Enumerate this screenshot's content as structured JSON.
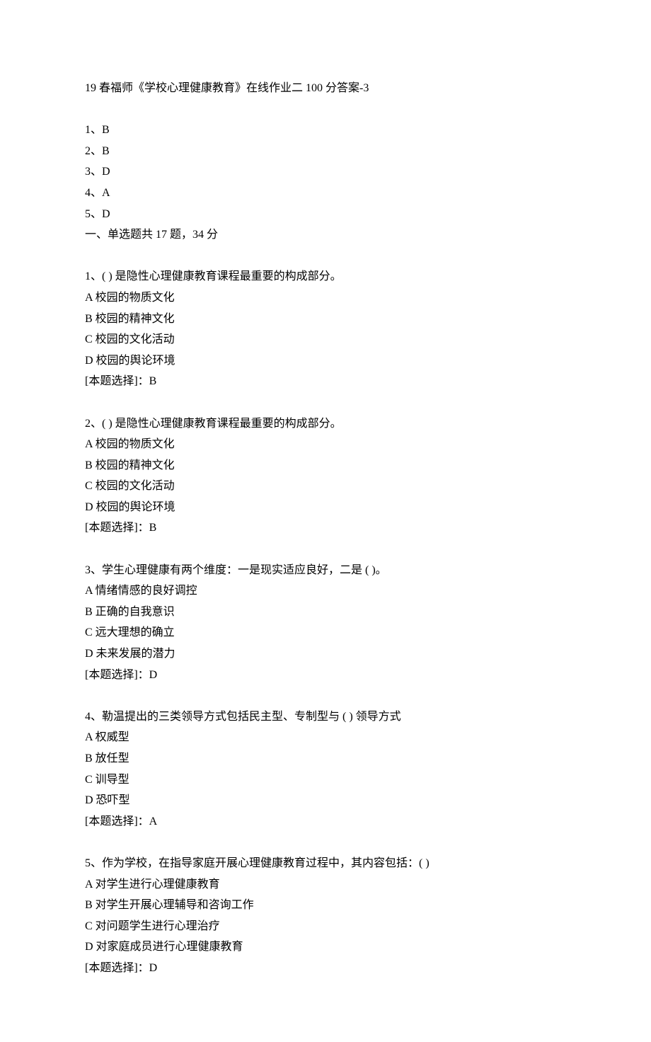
{
  "title": "19 春福师《学校心理健康教育》在线作业二 100 分答案-3",
  "quickAnswers": [
    {
      "num": "1、",
      "ans": "B"
    },
    {
      "num": "2、",
      "ans": "B"
    },
    {
      "num": "3、",
      "ans": "D"
    },
    {
      "num": "4、",
      "ans": "A"
    },
    {
      "num": "5、",
      "ans": "D"
    }
  ],
  "sectionHeader": "一、单选题共 17 题，34 分",
  "questions": [
    {
      "stem": "1、(  ) 是隐性心理健康教育课程最重要的构成部分。",
      "options": [
        "A 校园的物质文化",
        "B 校园的精神文化",
        "C 校园的文化活动",
        "D 校园的舆论环境"
      ],
      "answer": "[本题选择]：B"
    },
    {
      "stem": "2、(  ) 是隐性心理健康教育课程最重要的构成部分。",
      "options": [
        "A 校园的物质文化",
        "B 校园的精神文化",
        "C 校园的文化活动",
        "D 校园的舆论环境"
      ],
      "answer": "[本题选择]：B"
    },
    {
      "stem": "3、学生心理健康有两个维度：一是现实适应良好，二是 (  )。",
      "options": [
        "A 情绪情感的良好调控",
        "B 正确的自我意识",
        "C 远大理想的确立",
        "D 未来发展的潜力"
      ],
      "answer": "[本题选择]：D"
    },
    {
      "stem": "4、勒温提出的三类领导方式包括民主型、专制型与 (  ) 领导方式",
      "options": [
        "A 权威型",
        "B 放任型",
        "C 训导型",
        "D 恐吓型"
      ],
      "answer": "[本题选择]：A"
    },
    {
      "stem": "5、作为学校，在指导家庭开展心理健康教育过程中，其内容包括：(  )",
      "options": [
        "A 对学生进行心理健康教育",
        "B 对学生开展心理辅导和咨询工作",
        "C 对问题学生进行心理治疗",
        "D 对家庭成员进行心理健康教育"
      ],
      "answer": "[本题选择]：D"
    }
  ]
}
